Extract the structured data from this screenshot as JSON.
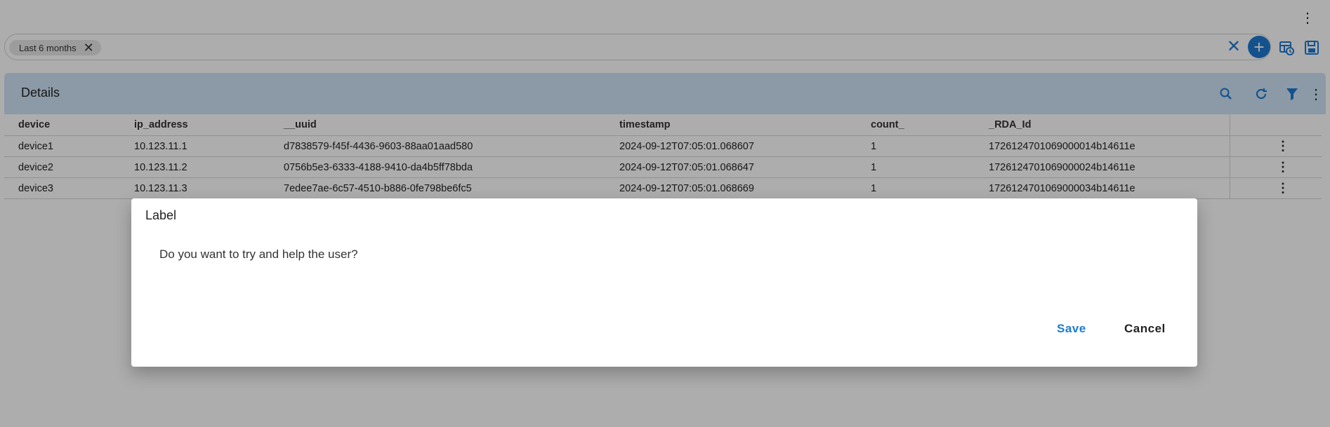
{
  "filter_bar": {
    "chip_label": "Last 6 months"
  },
  "panel": {
    "title": "Details"
  },
  "table": {
    "columns": [
      "device",
      "ip_address",
      "__uuid",
      "timestamp",
      "count_",
      "_RDA_Id"
    ],
    "rows": [
      [
        "device1",
        "10.123.11.1",
        "d7838579-f45f-4436-9603-88aa01aad580",
        "2024-09-12T07:05:01.068607",
        "1",
        "1726124701069000014b14611e"
      ],
      [
        "device2",
        "10.123.11.2",
        "0756b5e3-6333-4188-9410-da4b5ff78bda",
        "2024-09-12T07:05:01.068647",
        "1",
        "1726124701069000024b14611e"
      ],
      [
        "device3",
        "10.123.11.3",
        "7edee7ae-6c57-4510-b886-0fe798be6fc5",
        "2024-09-12T07:05:01.068669",
        "1",
        "1726124701069000034b14611e"
      ]
    ]
  },
  "dialog": {
    "title": "Label",
    "message": "Do you want to try and help the user?",
    "save_label": "Save",
    "cancel_label": "Cancel"
  },
  "colors": {
    "accent": "#1e7ad1",
    "header_bg": "#cfe4f7",
    "link": "#1e6fc4"
  },
  "icons": {
    "top_menu": "more-vert-icon",
    "chip_remove": "close-icon",
    "clear_filters": "close-icon",
    "add_filter": "add-icon",
    "table_time": "table-clock-icon",
    "save_view": "save-icon",
    "search": "search-icon",
    "refresh": "refresh-icon",
    "filter": "filter-icon",
    "panel_menu": "more-vert-icon",
    "row_action": "more-vert-icon"
  }
}
